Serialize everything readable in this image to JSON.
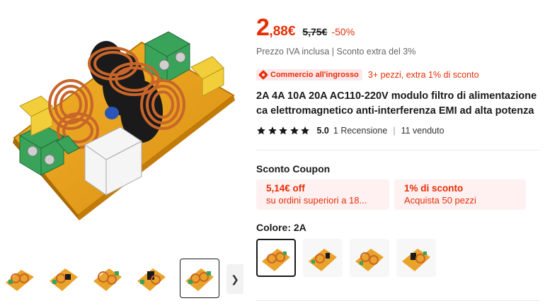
{
  "price": {
    "integer": "2",
    "decimal": ",88€",
    "original": "5,75€",
    "discount": "-50%"
  },
  "tax_info": "Prezzo IVA inclusa | Sconto extra del 3%",
  "wholesale": {
    "badge": "Commercio all'ingrosso",
    "text": "3+ pezzi, extra 1% di sconto"
  },
  "title": "2A 4A 10A 20A AC110-220V modulo filtro di alimentazione ca elettromagnetico anti-interferenza EMI ad alta potenza",
  "rating": {
    "stars": 5,
    "value": "5.0",
    "reviews": "1 Recensione",
    "separator": "|",
    "sold": "11 venduto"
  },
  "coupons": {
    "title": "Sconto Coupon",
    "items": [
      {
        "main": "5,14€ off",
        "sub": "su ordini superiori a 18..."
      },
      {
        "main": "1% di sconto",
        "sub": "Acquista 50 pezzi"
      }
    ]
  },
  "color": {
    "label": "Colore: 2A",
    "selected_index": 0,
    "swatch_count": 4
  },
  "gallery": {
    "thumb_count": 5,
    "selected_thumb": 4,
    "next_icon": "chevron-right-icon"
  },
  "colors": {
    "accent": "#e62e04",
    "badge_bg": "#fde7ea",
    "coupon_bg": "#fff0f1"
  }
}
